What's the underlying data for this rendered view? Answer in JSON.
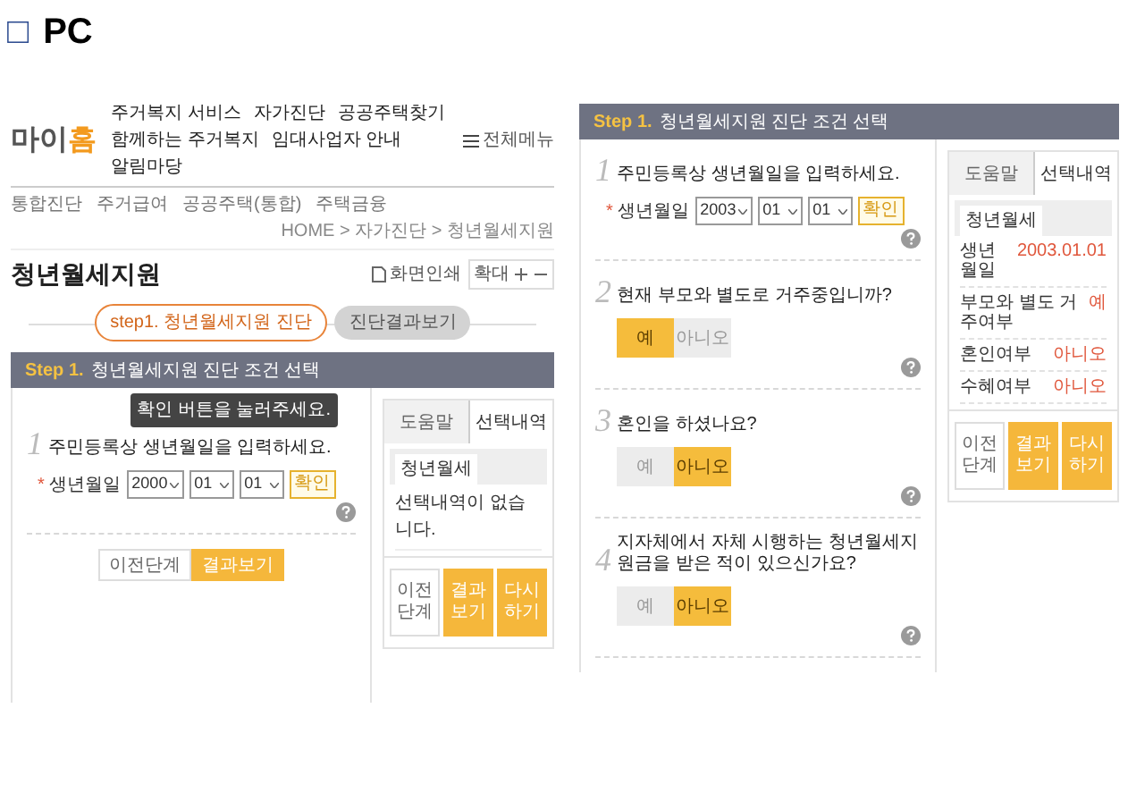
{
  "heading": {
    "box": "□",
    "title": "PC"
  },
  "left_screen": {
    "logo": [
      "마이",
      "홈"
    ],
    "nav": [
      "주거복지 서비스",
      "자가진단",
      "공공주택찾기",
      "함께하는 주거복지",
      "임대사업자 안내",
      "알림마당"
    ],
    "all_menu": "전체메뉴",
    "subnav": [
      "통합진단",
      "주거급여",
      "공공주택(통합)",
      "주택금융"
    ],
    "breadcrumb": "HOME > 자가진단 > 청년월세지원",
    "page_title": "청년월세지원",
    "print": "화면인쇄",
    "zoom": "확대",
    "steps": [
      {
        "label": "step1. 청년월세지원 진단",
        "selected": true
      },
      {
        "label": "진단결과보기",
        "selected": false
      }
    ],
    "form": {
      "bar": {
        "step": "Step 1.",
        "title": "청년월세지원 진단 조건 선택"
      },
      "questions": [
        {
          "kind": "birthdate",
          "number": "1",
          "text": "주민등록상 생년월일을 입력하세요.",
          "required": "*",
          "field_label": "생년월일",
          "selects": [
            "2000",
            "01",
            "01"
          ],
          "confirm": "확인",
          "tooltip": "확인 버튼을 눌러주세요."
        }
      ],
      "buttons": [
        {
          "label": "이전단계",
          "primary": false
        },
        {
          "label": "결과보기",
          "primary": true
        }
      ],
      "side": {
        "tabs": [
          {
            "label": "도움말",
            "selected": false
          },
          {
            "label": "선택내역",
            "selected": true
          }
        ],
        "subtab": "청년월세",
        "empty": "선택내역이 없습니다.",
        "buttons": [
          {
            "label": "이전단계",
            "primary": false
          },
          {
            "label": "결과보기",
            "primary": true
          },
          {
            "label": "다시하기",
            "primary": true
          }
        ]
      }
    }
  },
  "right_screen": {
    "form": {
      "bar": {
        "step": "Step 1.",
        "title": "청년월세지원 진단 조건 선택"
      },
      "questions": [
        {
          "kind": "birthdate",
          "number": "1",
          "text": "주민등록상 생년월일을 입력하세요.",
          "required": "*",
          "field_label": "생년월일",
          "selects": [
            "2003",
            "01",
            "01"
          ],
          "confirm": "확인"
        },
        {
          "kind": "choice",
          "number": "2",
          "text": "현재 부모와 별도로 거주중입니까?",
          "options": [
            {
              "label": "예",
              "selected": true
            },
            {
              "label": "아니오",
              "selected": false
            }
          ]
        },
        {
          "kind": "choice",
          "number": "3",
          "text": "혼인을 하셨나요?",
          "options": [
            {
              "label": "예",
              "selected": false
            },
            {
              "label": "아니오",
              "selected": true
            }
          ]
        },
        {
          "kind": "choice",
          "number": "4",
          "text": "지자체에서 자체 시행하는 청년월세지원금을 받은 적이 있으신가요?",
          "options": [
            {
              "label": "예",
              "selected": false
            },
            {
              "label": "아니오",
              "selected": true
            }
          ]
        }
      ],
      "side": {
        "tabs": [
          {
            "label": "도움말",
            "selected": false
          },
          {
            "label": "선택내역",
            "selected": true
          }
        ],
        "subtab": "청년월세",
        "rows": [
          {
            "label": "생년월일",
            "value": "2003.01.01"
          },
          {
            "label": "부모와 별도 거주여부",
            "value": "예"
          },
          {
            "label": "혼인여부",
            "value": "아니오"
          },
          {
            "label": "수혜여부",
            "value": "아니오"
          }
        ],
        "buttons": [
          {
            "label": "이전단계",
            "primary": false
          },
          {
            "label": "결과보기",
            "primary": true
          },
          {
            "label": "다시하기",
            "primary": true
          }
        ]
      }
    }
  }
}
